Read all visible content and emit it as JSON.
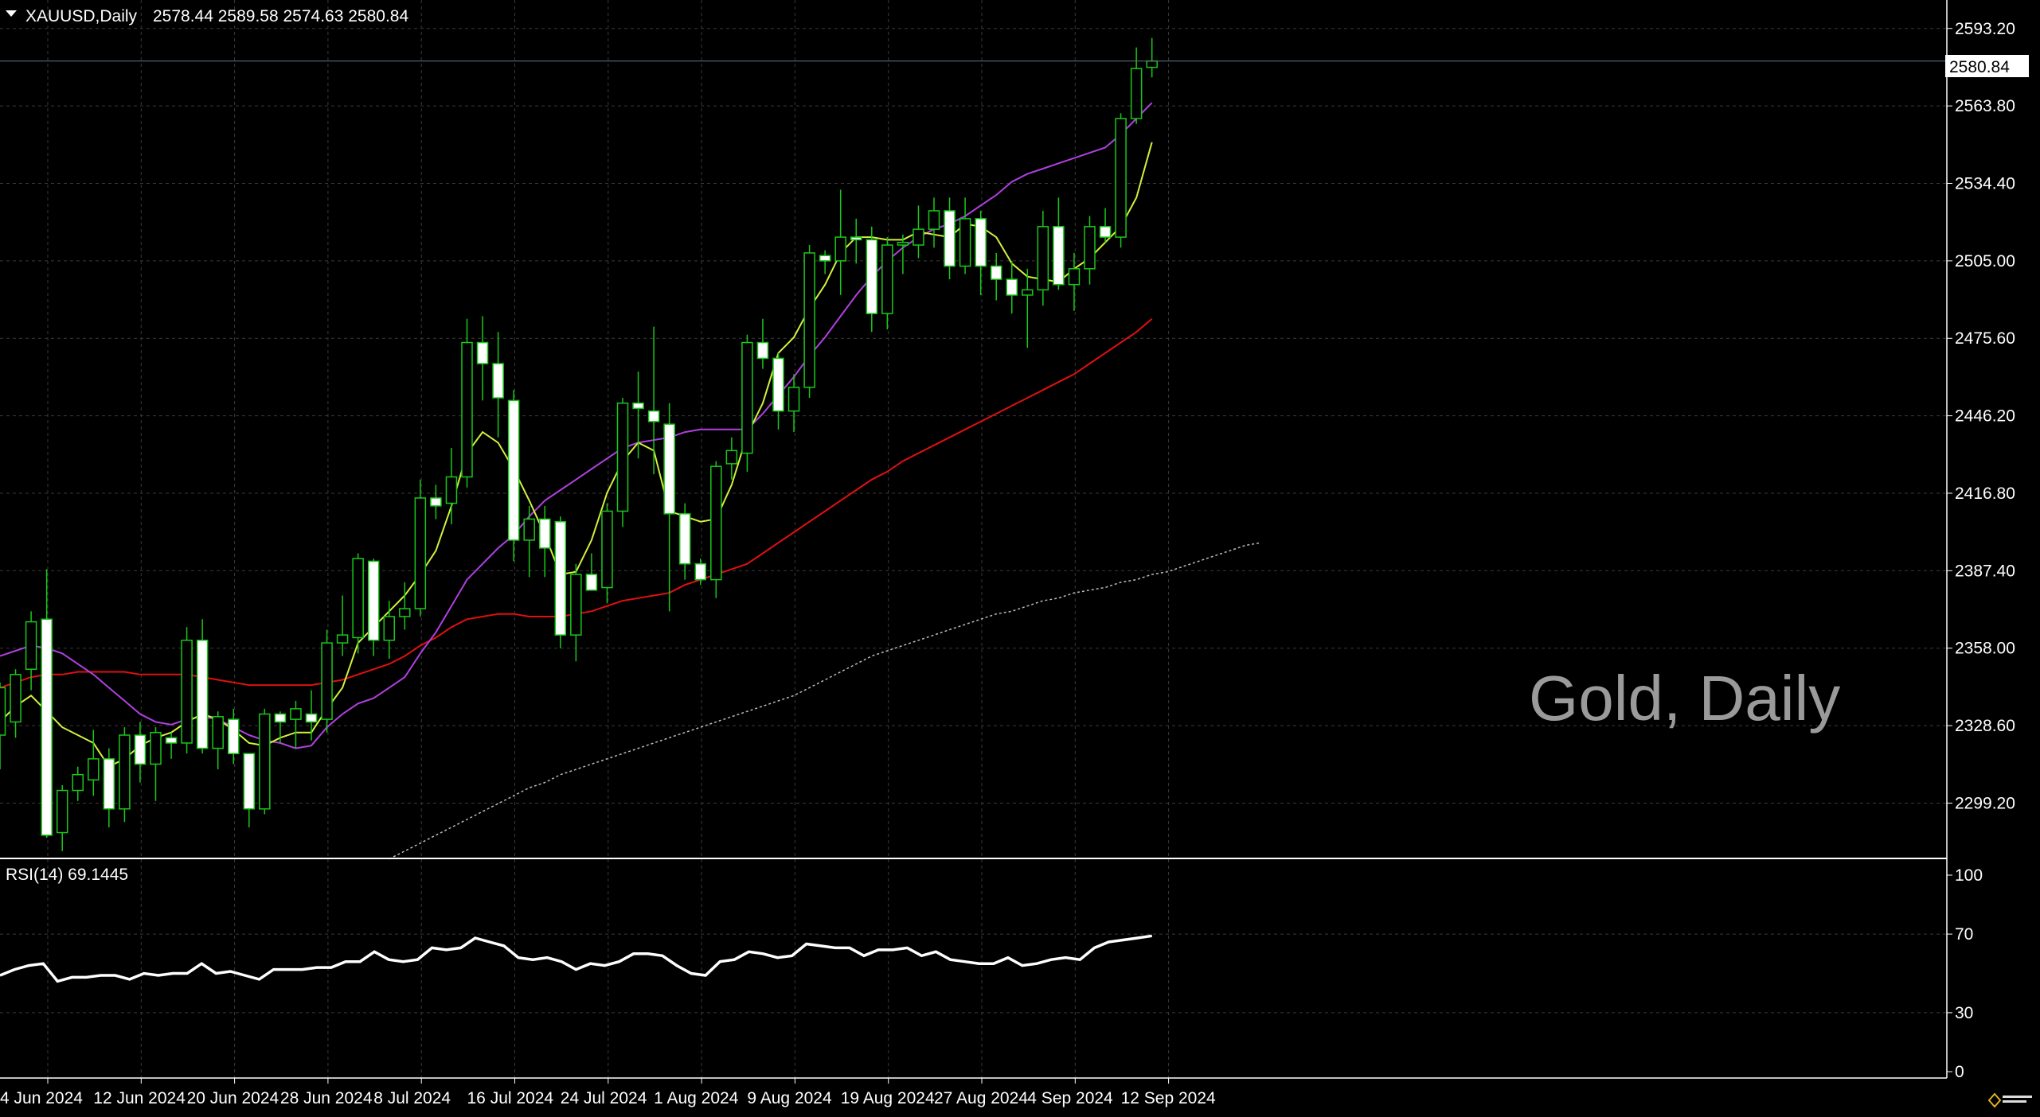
{
  "header": {
    "symbol_timeframe": "XAUUSD,Daily",
    "ohlc": "2578.44 2589.58 2574.63 2580.84",
    "menu_icon": "triangle-down-icon"
  },
  "watermark": "Gold, Daily",
  "price_label": "2580.84",
  "rsi_header": "RSI(14) 69.1445",
  "logo_text": "RoboForex-like logo",
  "colors": {
    "background": "#000000",
    "grid": "#3a3a3a",
    "bull_body": "#000000",
    "bear_body": "#ffffff",
    "candle_outline": "#19c819",
    "ma_fast": "#d4f03c",
    "ma_mid": "#b040e0",
    "ma_slow": "#e01010",
    "ma_long": "#bbbbbb",
    "rsi": "#ffffff",
    "text": "#ffffff",
    "watermark": "#9a9a9a"
  },
  "chart_data": {
    "type": "candlestick",
    "symbol": "XAUUSD",
    "timeframe": "Daily",
    "y_ticks": [
      2299.2,
      2328.6,
      2358.0,
      2387.4,
      2416.8,
      2446.2,
      2475.6,
      2505.0,
      2534.4,
      2563.8,
      2593.2
    ],
    "y_tick_labels": [
      "2299.20",
      "2328.60",
      "2358.00",
      "2387.40",
      "2416.80",
      "2446.20",
      "2475.60",
      "2505.00",
      "2534.40",
      "2563.80",
      "2593.20"
    ],
    "ylim": [
      2278.5,
      2604.0
    ],
    "last_price": 2580.84,
    "x_tick_labels": [
      "4 Jun 2024",
      "12 Jun 2024",
      "20 Jun 2024",
      "28 Jun 2024",
      "8 Jul 2024",
      "16 Jul 2024",
      "24 Jul 2024",
      "1 Aug 2024",
      "9 Aug 2024",
      "19 Aug 2024",
      "27 Aug 2024",
      "4 Sep 2024",
      "12 Sep 2024"
    ],
    "x_tick_index": [
      0,
      6,
      12,
      18,
      24,
      30,
      36,
      42,
      48,
      54,
      60,
      66,
      72
    ],
    "candles": [
      {
        "o": 2325,
        "h": 2345,
        "l": 2312,
        "c": 2343
      },
      {
        "o": 2330,
        "h": 2350,
        "l": 2324,
        "c": 2348
      },
      {
        "o": 2350,
        "h": 2372,
        "l": 2342,
        "c": 2368
      },
      {
        "o": 2369,
        "h": 2388,
        "l": 2286,
        "c": 2287
      },
      {
        "o": 2288,
        "h": 2306,
        "l": 2281,
        "c": 2304
      },
      {
        "o": 2304,
        "h": 2313,
        "l": 2300,
        "c": 2310
      },
      {
        "o": 2308,
        "h": 2327,
        "l": 2302,
        "c": 2316
      },
      {
        "o": 2316,
        "h": 2320,
        "l": 2290,
        "c": 2297
      },
      {
        "o": 2297,
        "h": 2328,
        "l": 2292,
        "c": 2325
      },
      {
        "o": 2325,
        "h": 2330,
        "l": 2307,
        "c": 2314
      },
      {
        "o": 2314,
        "h": 2328,
        "l": 2300,
        "c": 2326
      },
      {
        "o": 2324,
        "h": 2326,
        "l": 2316,
        "c": 2322
      },
      {
        "o": 2322,
        "h": 2366,
        "l": 2318,
        "c": 2361
      },
      {
        "o": 2361,
        "h": 2369,
        "l": 2318,
        "c": 2320
      },
      {
        "o": 2320,
        "h": 2334,
        "l": 2312,
        "c": 2332
      },
      {
        "o": 2331,
        "h": 2335,
        "l": 2314,
        "c": 2318
      },
      {
        "o": 2318,
        "h": 2318,
        "l": 2290,
        "c": 2297
      },
      {
        "o": 2297,
        "h": 2335,
        "l": 2295,
        "c": 2333
      },
      {
        "o": 2333,
        "h": 2334,
        "l": 2322,
        "c": 2330
      },
      {
        "o": 2331,
        "h": 2338,
        "l": 2320,
        "c": 2335
      },
      {
        "o": 2333,
        "h": 2342,
        "l": 2323,
        "c": 2330
      },
      {
        "o": 2331,
        "h": 2365,
        "l": 2326,
        "c": 2360
      },
      {
        "o": 2360,
        "h": 2378,
        "l": 2355,
        "c": 2363
      },
      {
        "o": 2362,
        "h": 2394,
        "l": 2356,
        "c": 2392
      },
      {
        "o": 2391,
        "h": 2392,
        "l": 2355,
        "c": 2361
      },
      {
        "o": 2361,
        "h": 2376,
        "l": 2354,
        "c": 2370
      },
      {
        "o": 2370,
        "h": 2383,
        "l": 2365,
        "c": 2373
      },
      {
        "o": 2373,
        "h": 2422,
        "l": 2370,
        "c": 2415
      },
      {
        "o": 2415,
        "h": 2420,
        "l": 2407,
        "c": 2412
      },
      {
        "o": 2413,
        "h": 2434,
        "l": 2405,
        "c": 2423
      },
      {
        "o": 2423,
        "h": 2483,
        "l": 2419,
        "c": 2474
      },
      {
        "o": 2474,
        "h": 2484,
        "l": 2452,
        "c": 2466
      },
      {
        "o": 2466,
        "h": 2478,
        "l": 2438,
        "c": 2453
      },
      {
        "o": 2452,
        "h": 2456,
        "l": 2391,
        "c": 2399
      },
      {
        "o": 2399,
        "h": 2412,
        "l": 2385,
        "c": 2407
      },
      {
        "o": 2407,
        "h": 2412,
        "l": 2385,
        "c": 2396
      },
      {
        "o": 2406,
        "h": 2408,
        "l": 2358,
        "c": 2363
      },
      {
        "o": 2363,
        "h": 2390,
        "l": 2353,
        "c": 2386
      },
      {
        "o": 2386,
        "h": 2394,
        "l": 2380,
        "c": 2380
      },
      {
        "o": 2381,
        "h": 2413,
        "l": 2375,
        "c": 2410
      },
      {
        "o": 2410,
        "h": 2453,
        "l": 2404,
        "c": 2451
      },
      {
        "o": 2451,
        "h": 2463,
        "l": 2430,
        "c": 2449
      },
      {
        "o": 2448,
        "h": 2480,
        "l": 2424,
        "c": 2444
      },
      {
        "o": 2443,
        "h": 2451,
        "l": 2372,
        "c": 2409
      },
      {
        "o": 2409,
        "h": 2413,
        "l": 2384,
        "c": 2390
      },
      {
        "o": 2390,
        "h": 2392,
        "l": 2382,
        "c": 2384
      },
      {
        "o": 2384,
        "h": 2429,
        "l": 2377,
        "c": 2427
      },
      {
        "o": 2428,
        "h": 2438,
        "l": 2422,
        "c": 2433
      },
      {
        "o": 2432,
        "h": 2477,
        "l": 2425,
        "c": 2474
      },
      {
        "o": 2474,
        "h": 2483,
        "l": 2464,
        "c": 2468
      },
      {
        "o": 2468,
        "h": 2470,
        "l": 2441,
        "c": 2448
      },
      {
        "o": 2448,
        "h": 2462,
        "l": 2440,
        "c": 2457
      },
      {
        "o": 2457,
        "h": 2511,
        "l": 2453,
        "c": 2508
      },
      {
        "o": 2507,
        "h": 2509,
        "l": 2500,
        "c": 2505
      },
      {
        "o": 2505,
        "h": 2532,
        "l": 2492,
        "c": 2514
      },
      {
        "o": 2514,
        "h": 2521,
        "l": 2504,
        "c": 2513
      },
      {
        "o": 2513,
        "h": 2518,
        "l": 2478,
        "c": 2485
      },
      {
        "o": 2485,
        "h": 2514,
        "l": 2479,
        "c": 2511
      },
      {
        "o": 2511,
        "h": 2515,
        "l": 2500,
        "c": 2512
      },
      {
        "o": 2511,
        "h": 2526,
        "l": 2506,
        "c": 2517
      },
      {
        "o": 2517,
        "h": 2529,
        "l": 2510,
        "c": 2524
      },
      {
        "o": 2524,
        "h": 2529,
        "l": 2498,
        "c": 2503
      },
      {
        "o": 2503,
        "h": 2529,
        "l": 2500,
        "c": 2521
      },
      {
        "o": 2521,
        "h": 2524,
        "l": 2492,
        "c": 2503
      },
      {
        "o": 2503,
        "h": 2508,
        "l": 2490,
        "c": 2498
      },
      {
        "o": 2498,
        "h": 2505,
        "l": 2485,
        "c": 2492
      },
      {
        "o": 2492,
        "h": 2502,
        "l": 2472,
        "c": 2494
      },
      {
        "o": 2494,
        "h": 2524,
        "l": 2488,
        "c": 2518
      },
      {
        "o": 2518,
        "h": 2529,
        "l": 2494,
        "c": 2496
      },
      {
        "o": 2496,
        "h": 2508,
        "l": 2486,
        "c": 2502
      },
      {
        "o": 2502,
        "h": 2522,
        "l": 2496,
        "c": 2518
      },
      {
        "o": 2518,
        "h": 2525,
        "l": 2512,
        "c": 2514
      },
      {
        "o": 2514,
        "h": 2561,
        "l": 2510,
        "c": 2559
      },
      {
        "o": 2559,
        "h": 2586,
        "l": 2557,
        "c": 2578
      },
      {
        "o": 2578.44,
        "h": 2589.58,
        "l": 2574.63,
        "c": 2580.84
      }
    ],
    "ma_fast": [
      2330,
      2336,
      2340,
      2334,
      2328,
      2325,
      2322,
      2313,
      2316,
      2321,
      2324,
      2326,
      2330,
      2333,
      2331,
      2327,
      2322,
      2321,
      2324,
      2326,
      2326,
      2335,
      2343,
      2360,
      2366,
      2372,
      2378,
      2386,
      2395,
      2412,
      2432,
      2440,
      2436,
      2426,
      2414,
      2401,
      2386,
      2387,
      2399,
      2417,
      2429,
      2436,
      2433,
      2410,
      2408,
      2406,
      2407,
      2420,
      2439,
      2451,
      2470,
      2476,
      2487,
      2496,
      2508,
      2514,
      2514,
      2513,
      2513,
      2516,
      2515,
      2514,
      2519,
      2518,
      2514,
      2504,
      2499,
      2498,
      2497,
      2502,
      2506,
      2512,
      2518,
      2529,
      2550
    ],
    "ma_mid": [
      2355,
      2357,
      2359,
      2358,
      2356,
      2352,
      2348,
      2343,
      2338,
      2333,
      2330,
      2329,
      2331,
      2332,
      2331,
      2328,
      2325,
      2323,
      2322,
      2320,
      2321,
      2328,
      2333,
      2337,
      2339,
      2343,
      2347,
      2356,
      2364,
      2374,
      2384,
      2390,
      2396,
      2401,
      2408,
      2414,
      2418,
      2422,
      2426,
      2430,
      2434,
      2436,
      2437,
      2438,
      2440,
      2441,
      2441,
      2441,
      2441,
      2447,
      2454,
      2461,
      2469,
      2476,
      2484,
      2492,
      2499,
      2505,
      2510,
      2514,
      2517,
      2519,
      2522,
      2526,
      2530,
      2535,
      2538,
      2540,
      2542,
      2544,
      2546,
      2548,
      2553,
      2559,
      2565
    ],
    "ma_slow": [
      2343,
      2345,
      2347,
      2348,
      2348,
      2349,
      2349,
      2349,
      2349,
      2348,
      2348,
      2348,
      2348,
      2347,
      2346,
      2345,
      2344,
      2344,
      2344,
      2344,
      2344,
      2345,
      2346,
      2348,
      2350,
      2352,
      2355,
      2359,
      2362,
      2366,
      2369,
      2370,
      2371,
      2371,
      2370,
      2370,
      2370,
      2371,
      2372,
      2374,
      2376,
      2377,
      2378,
      2379,
      2382,
      2384,
      2386,
      2388,
      2390,
      2394,
      2398,
      2402,
      2406,
      2410,
      2414,
      2418,
      2422,
      2425,
      2429,
      2432,
      2435,
      2438,
      2441,
      2444,
      2447,
      2450,
      2453,
      2456,
      2459,
      2462,
      2466,
      2470,
      2474,
      2478,
      2483
    ],
    "ma_long_start_index": 25,
    "ma_long": [
      2278,
      2281,
      2284,
      2287,
      2290,
      2293,
      2296,
      2299,
      2302,
      2305,
      2307,
      2310,
      2312,
      2314,
      2316,
      2318,
      2320,
      2322,
      2324,
      2326,
      2328,
      2330,
      2332,
      2334,
      2336,
      2338,
      2340,
      2343,
      2346,
      2349,
      2352,
      2355,
      2357,
      2359,
      2361,
      2363,
      2365,
      2367,
      2369,
      2371,
      2372,
      2374,
      2376,
      2377,
      2379,
      2380,
      2381,
      2383,
      2384,
      2386,
      2387,
      2389,
      2391,
      2393,
      2395,
      2397,
      2398
    ],
    "rsi": {
      "name": "RSI(14)",
      "last": 69.1445,
      "ylim": [
        0,
        100
      ],
      "y_ticks": [
        100,
        70,
        30,
        0
      ],
      "values": [
        49,
        52,
        54,
        55,
        46,
        48,
        48,
        49,
        49,
        47,
        50,
        49,
        50,
        50,
        55,
        50,
        51,
        49,
        47,
        52,
        52,
        52,
        53,
        53,
        56,
        56,
        61,
        57,
        56,
        57,
        63,
        62,
        63,
        68,
        66,
        64,
        58,
        57,
        58,
        56,
        52,
        55,
        54,
        56,
        60,
        60,
        59,
        54,
        50,
        49,
        56,
        57,
        61,
        60,
        58,
        59,
        65,
        64,
        63,
        63,
        59,
        62,
        62,
        63,
        59,
        61,
        57,
        56,
        55,
        55,
        58,
        54,
        55,
        57,
        58,
        57,
        63,
        66,
        67,
        68,
        69.1
      ]
    }
  }
}
